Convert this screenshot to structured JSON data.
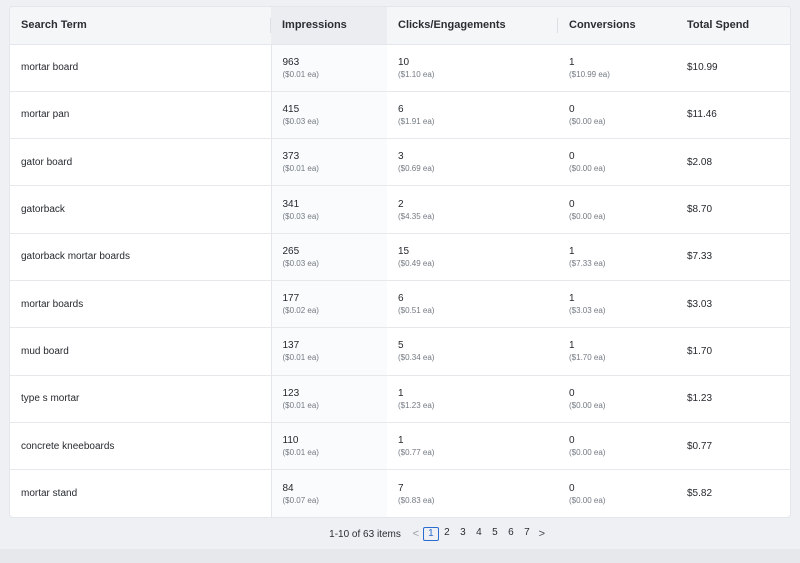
{
  "table": {
    "headers": [
      "Search Term",
      "Impressions",
      "Clicks/Engagements",
      "Conversions",
      "Total Spend"
    ],
    "rows": [
      {
        "term": "mortar board",
        "impressions": "963",
        "impressions_ea": "($0.01 ea)",
        "clicks": "10",
        "clicks_ea": "($1.10 ea)",
        "conversions": "1",
        "conversions_ea": "($10.99 ea)",
        "spend": "$10.99"
      },
      {
        "term": "mortar pan",
        "impressions": "415",
        "impressions_ea": "($0.03 ea)",
        "clicks": "6",
        "clicks_ea": "($1.91 ea)",
        "conversions": "0",
        "conversions_ea": "($0.00 ea)",
        "spend": "$11.46"
      },
      {
        "term": "gator board",
        "impressions": "373",
        "impressions_ea": "($0.01 ea)",
        "clicks": "3",
        "clicks_ea": "($0.69 ea)",
        "conversions": "0",
        "conversions_ea": "($0.00 ea)",
        "spend": "$2.08"
      },
      {
        "term": "gatorback",
        "impressions": "341",
        "impressions_ea": "($0.03 ea)",
        "clicks": "2",
        "clicks_ea": "($4.35 ea)",
        "conversions": "0",
        "conversions_ea": "($0.00 ea)",
        "spend": "$8.70"
      },
      {
        "term": "gatorback mortar boards",
        "impressions": "265",
        "impressions_ea": "($0.03 ea)",
        "clicks": "15",
        "clicks_ea": "($0.49 ea)",
        "conversions": "1",
        "conversions_ea": "($7.33 ea)",
        "spend": "$7.33"
      },
      {
        "term": "mortar boards",
        "impressions": "177",
        "impressions_ea": "($0.02 ea)",
        "clicks": "6",
        "clicks_ea": "($0.51 ea)",
        "conversions": "1",
        "conversions_ea": "($3.03 ea)",
        "spend": "$3.03"
      },
      {
        "term": "mud board",
        "impressions": "137",
        "impressions_ea": "($0.01 ea)",
        "clicks": "5",
        "clicks_ea": "($0.34 ea)",
        "conversions": "1",
        "conversions_ea": "($1.70 ea)",
        "spend": "$1.70"
      },
      {
        "term": "type s mortar",
        "impressions": "123",
        "impressions_ea": "($0.01 ea)",
        "clicks": "1",
        "clicks_ea": "($1.23 ea)",
        "conversions": "0",
        "conversions_ea": "($0.00 ea)",
        "spend": "$1.23"
      },
      {
        "term": "concrete kneeboards",
        "impressions": "110",
        "impressions_ea": "($0.01 ea)",
        "clicks": "1",
        "clicks_ea": "($0.77 ea)",
        "conversions": "0",
        "conversions_ea": "($0.00 ea)",
        "spend": "$0.77"
      },
      {
        "term": "mortar stand",
        "impressions": "84",
        "impressions_ea": "($0.07 ea)",
        "clicks": "7",
        "clicks_ea": "($0.83 ea)",
        "conversions": "0",
        "conversions_ea": "($0.00 ea)",
        "spend": "$5.82"
      }
    ]
  },
  "pagination": {
    "summary": "1-10 of 63 items",
    "prev_icon": "<",
    "next_icon": ">",
    "pages": [
      "1",
      "2",
      "3",
      "4",
      "5",
      "6",
      "7"
    ],
    "current_page": "1"
  },
  "colors": {
    "accent": "#2b6cd1",
    "header_bg": "#f5f6f8",
    "border": "#e3e6ea"
  }
}
